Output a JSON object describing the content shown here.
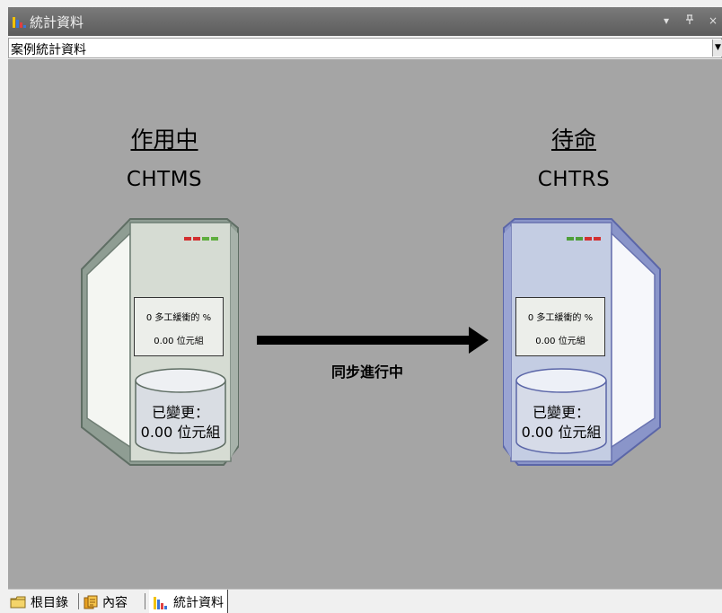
{
  "window": {
    "title": "統計資料",
    "pin_glyph": "▾",
    "pin2_glyph": "ₜ",
    "close_glyph": "×"
  },
  "view_selector": {
    "selected": "案例統計資料"
  },
  "active_server": {
    "role": "作用中",
    "name": "CHTMS",
    "stats_line1": "0 多工緩衝的 %",
    "stats_line2": "0.00 位元組",
    "changed_label": "已變更：",
    "changed_value": "0.00 位元組",
    "body_color": "#d6dcd3",
    "frame_color": "#7f8e84"
  },
  "standby_server": {
    "role": "待命",
    "name": "CHTRS",
    "stats_line1": "0 多工緩衝的 %",
    "stats_line2": "0.00 位元組",
    "changed_label": "已變更：",
    "changed_value": "0.00 位元組",
    "body_color": "#c4cde3",
    "frame_color": "#7c88c0"
  },
  "sync_status": "同步進行中",
  "tabs": [
    {
      "label": "根目錄",
      "icon": "folder-icon",
      "active": false
    },
    {
      "label": "內容",
      "icon": "contents-icon",
      "active": false
    },
    {
      "label": "統計資料",
      "icon": "bar-chart-icon",
      "active": true
    }
  ],
  "colors": {
    "panel": "#a5a5a5",
    "titlebar": "#6b6b6b"
  }
}
